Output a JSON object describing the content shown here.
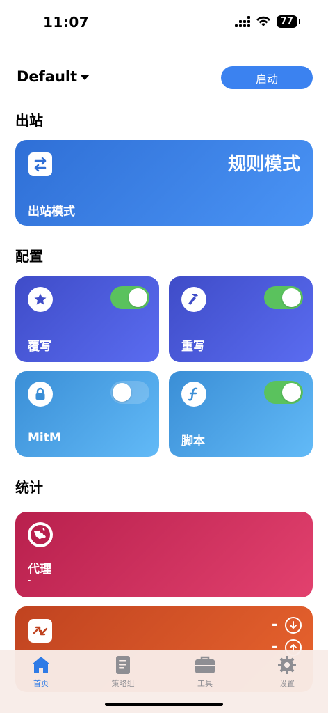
{
  "status_bar": {
    "time": "11:07",
    "battery": "77"
  },
  "header": {
    "profile_name": "Default",
    "start_label": "启动"
  },
  "outbound": {
    "section_title": "出站",
    "mode_value": "规则模式",
    "label": "出站模式"
  },
  "config": {
    "section_title": "配置",
    "items": [
      {
        "label": "覆写",
        "enabled": true,
        "icon": "star-icon"
      },
      {
        "label": "重写",
        "enabled": true,
        "icon": "hammer-icon"
      },
      {
        "label": "MitM",
        "enabled": false,
        "icon": "lock-icon"
      },
      {
        "label": "脚本",
        "enabled": true,
        "icon": "script-f-icon"
      }
    ]
  },
  "stats": {
    "section_title": "统计",
    "proxy": {
      "label": "代理",
      "value": "-"
    },
    "traffic": {
      "download": "-",
      "upload": "-"
    }
  },
  "tabs": [
    {
      "label": "首页",
      "icon": "home-icon",
      "active": true
    },
    {
      "label": "策略组",
      "icon": "list-doc-icon",
      "active": false
    },
    {
      "label": "工具",
      "icon": "toolbox-icon",
      "active": false
    },
    {
      "label": "设置",
      "icon": "gear-icon",
      "active": false
    }
  ],
  "colors": {
    "accent": "#3b82f0",
    "toggle_on": "#5ac25d",
    "tab_active": "#2f7be6"
  }
}
